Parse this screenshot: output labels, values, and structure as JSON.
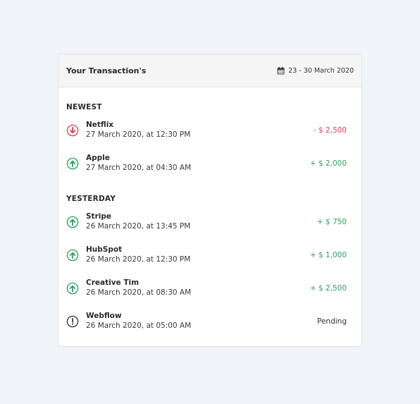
{
  "header": {
    "title": "Your Transaction's",
    "date_range": "23 - 30 March 2020",
    "calendar_icon": "calendar-icon"
  },
  "colors": {
    "negative": "#e04055",
    "positive": "#2e9f5f",
    "pending": "#333333"
  },
  "sections": [
    {
      "title": "NEWEST",
      "transactions": [
        {
          "name": "Netflix",
          "date": "27 March 2020, at 12:30 PM",
          "amount": "- $ 2,500",
          "type": "negative",
          "icon": "arrow-down-circle-icon"
        },
        {
          "name": "Apple",
          "date": "27 March 2020, at 04:30 AM",
          "amount": "+ $ 2,000",
          "type": "positive",
          "icon": "arrow-up-circle-icon"
        }
      ]
    },
    {
      "title": "YESTERDAY",
      "transactions": [
        {
          "name": "Stripe",
          "date": "26 March 2020, at 13:45 PM",
          "amount": "+ $ 750",
          "type": "positive",
          "icon": "arrow-up-circle-icon"
        },
        {
          "name": "HubSpot",
          "date": "26 March 2020, at 12:30 PM",
          "amount": "+ $ 1,000",
          "type": "positive",
          "icon": "arrow-up-circle-icon"
        },
        {
          "name": "Creative Tim",
          "date": "26 March 2020, at 08:30 AM",
          "amount": "+ $ 2,500",
          "type": "positive",
          "icon": "arrow-up-circle-icon"
        },
        {
          "name": "Webflow",
          "date": "26 March 2020, at 05:00 AM",
          "amount": "Pending",
          "type": "pending",
          "icon": "exclamation-circle-icon"
        }
      ]
    }
  ]
}
